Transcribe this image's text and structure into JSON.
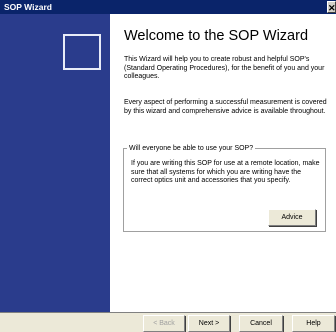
{
  "window": {
    "title": "SOP Wizard",
    "close_glyph": "✕"
  },
  "content": {
    "heading": "Welcome to the SOP Wizard",
    "paragraph1": "This Wizard will help you to create robust and helpful SOP's (Standard Operating Procedures), for the benefit of you and your colleagues.",
    "paragraph2": "Every aspect of performing a successful measurement is covered by this wizard and comprehensive advice is available throughout.",
    "group": {
      "legend": "Will everyone be able to use your SOP?",
      "text": "If you are writing this SOP for use at a remote location, make sure that all systems for which you are writing have the correct optics unit and accessories that you specify.",
      "advice_label": "Advice"
    }
  },
  "buttons": {
    "back": "< Back",
    "next": "Next >",
    "cancel": "Cancel",
    "help": "Help"
  },
  "colors": {
    "title_bar": "#0a246a",
    "side_panel": "#2a3c8c",
    "dialog_face": "#ece9d8"
  }
}
